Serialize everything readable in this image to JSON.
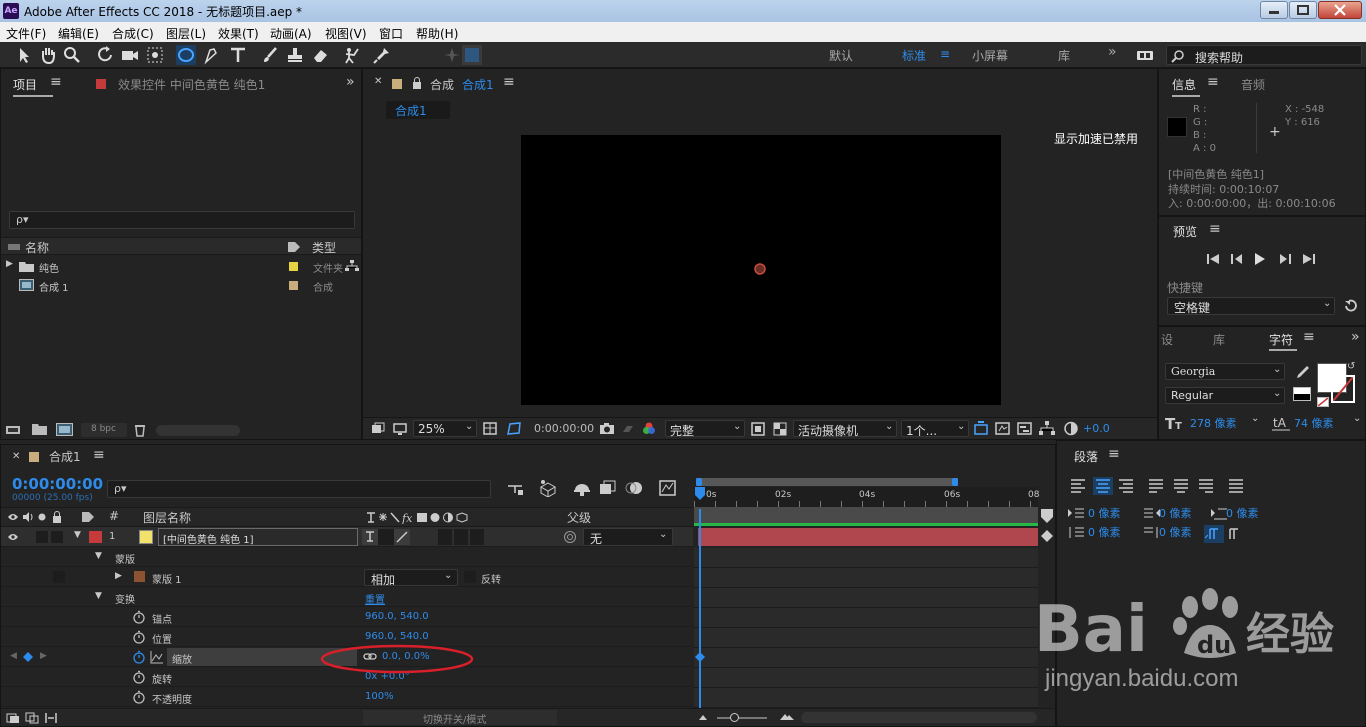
{
  "app": {
    "title": "Adobe After Effects CC 2018 - 无标题项目.aep *",
    "logo": "Ae"
  },
  "menu": [
    "文件(F)",
    "编辑(E)",
    "合成(C)",
    "图层(L)",
    "效果(T)",
    "动画(A)",
    "视图(V)",
    "窗口",
    "帮助(H)"
  ],
  "workspaces": {
    "default": "默认",
    "standard": "标准",
    "small": "小屏幕",
    "library": "库",
    "more": "»",
    "search_placeholder": "搜索帮助"
  },
  "project": {
    "tab_project": "项目",
    "tab_effects": "效果控件 中间色黄色 纯色1",
    "search_placeholder": "ρ▾",
    "col_name": "名称",
    "col_type": "类型",
    "items": [
      {
        "name": "纯色",
        "type": "文件夹",
        "color": "#e6d340"
      },
      {
        "name": "合成 1",
        "type": "合成",
        "color": "#c9ad7d"
      }
    ],
    "bpc": "8 bpc"
  },
  "comp_viewer": {
    "tab_label": "合成",
    "tab_name": "合成1",
    "subtab": "合成1",
    "accel_notice": "显示加速已禁用",
    "zoom": "25%",
    "timecode": "0:00:00:00",
    "resolution": "完整",
    "camera": "活动摄像机",
    "views": "1个...",
    "exposure": "+0.0"
  },
  "info": {
    "tab_info": "信息",
    "tab_audio": "音频",
    "r": "R :",
    "g": "G :",
    "b": "B :",
    "a": "A : 0",
    "x": "X : -548",
    "y": "Y : 616",
    "layer": "[中间色黄色 纯色1]",
    "duration": "持续时间: 0:00:10:07",
    "inout": "入: 0:00:00:00，出: 0:00:10:06"
  },
  "preview": {
    "title": "预览",
    "shortcut_label": "快捷键",
    "shortcut_value": "空格键"
  },
  "character": {
    "tab_set": "设",
    "tab_lib": "库",
    "tab_char": "字符",
    "font": "Georgia",
    "style": "Regular",
    "size": "278 像素",
    "leading": "74 像素"
  },
  "paragraph": {
    "title": "段落",
    "indent_left": "0 像素",
    "indent_right": "0 像素",
    "indent_first": "0 像素",
    "space_before": "0 像素",
    "space_after": "0 像素"
  },
  "timeline": {
    "tab": "合成1",
    "timecode": "0:00:00:00",
    "frames": "00000 (25.00 fps)",
    "search_placeholder": "ρ▾",
    "col_layer_name": "图层名称",
    "col_parent": "父级",
    "col_hash": "#",
    "layer": {
      "index": "1",
      "name": "[中间色黄色 纯色 1]",
      "parent": "无"
    },
    "mask_group": "蒙版",
    "mask": {
      "name": "蒙版 1",
      "mode": "相加",
      "invert": "反转"
    },
    "transform": {
      "label": "变换",
      "reset": "重置"
    },
    "props": [
      {
        "name": "锚点",
        "value": "960.0, 540.0"
      },
      {
        "name": "位置",
        "value": "960.0, 540.0"
      },
      {
        "name": "缩放",
        "value": "0.0, 0.0%"
      },
      {
        "name": "旋转",
        "value": "0x +0.0°"
      },
      {
        "name": "不透明度",
        "value": "100%"
      }
    ],
    "ruler": [
      "0s",
      "02s",
      "04s",
      "06s",
      "08"
    ],
    "switch_mode": "切换开关/模式"
  },
  "watermark": {
    "brand": "Bai du 经验",
    "url": "jingyan.baidu.com"
  },
  "colors": {
    "accent": "#2d8ceb",
    "layer_label": "#c53a3a",
    "layer_bar": "#b0474f",
    "annotation": "#d9202a"
  }
}
